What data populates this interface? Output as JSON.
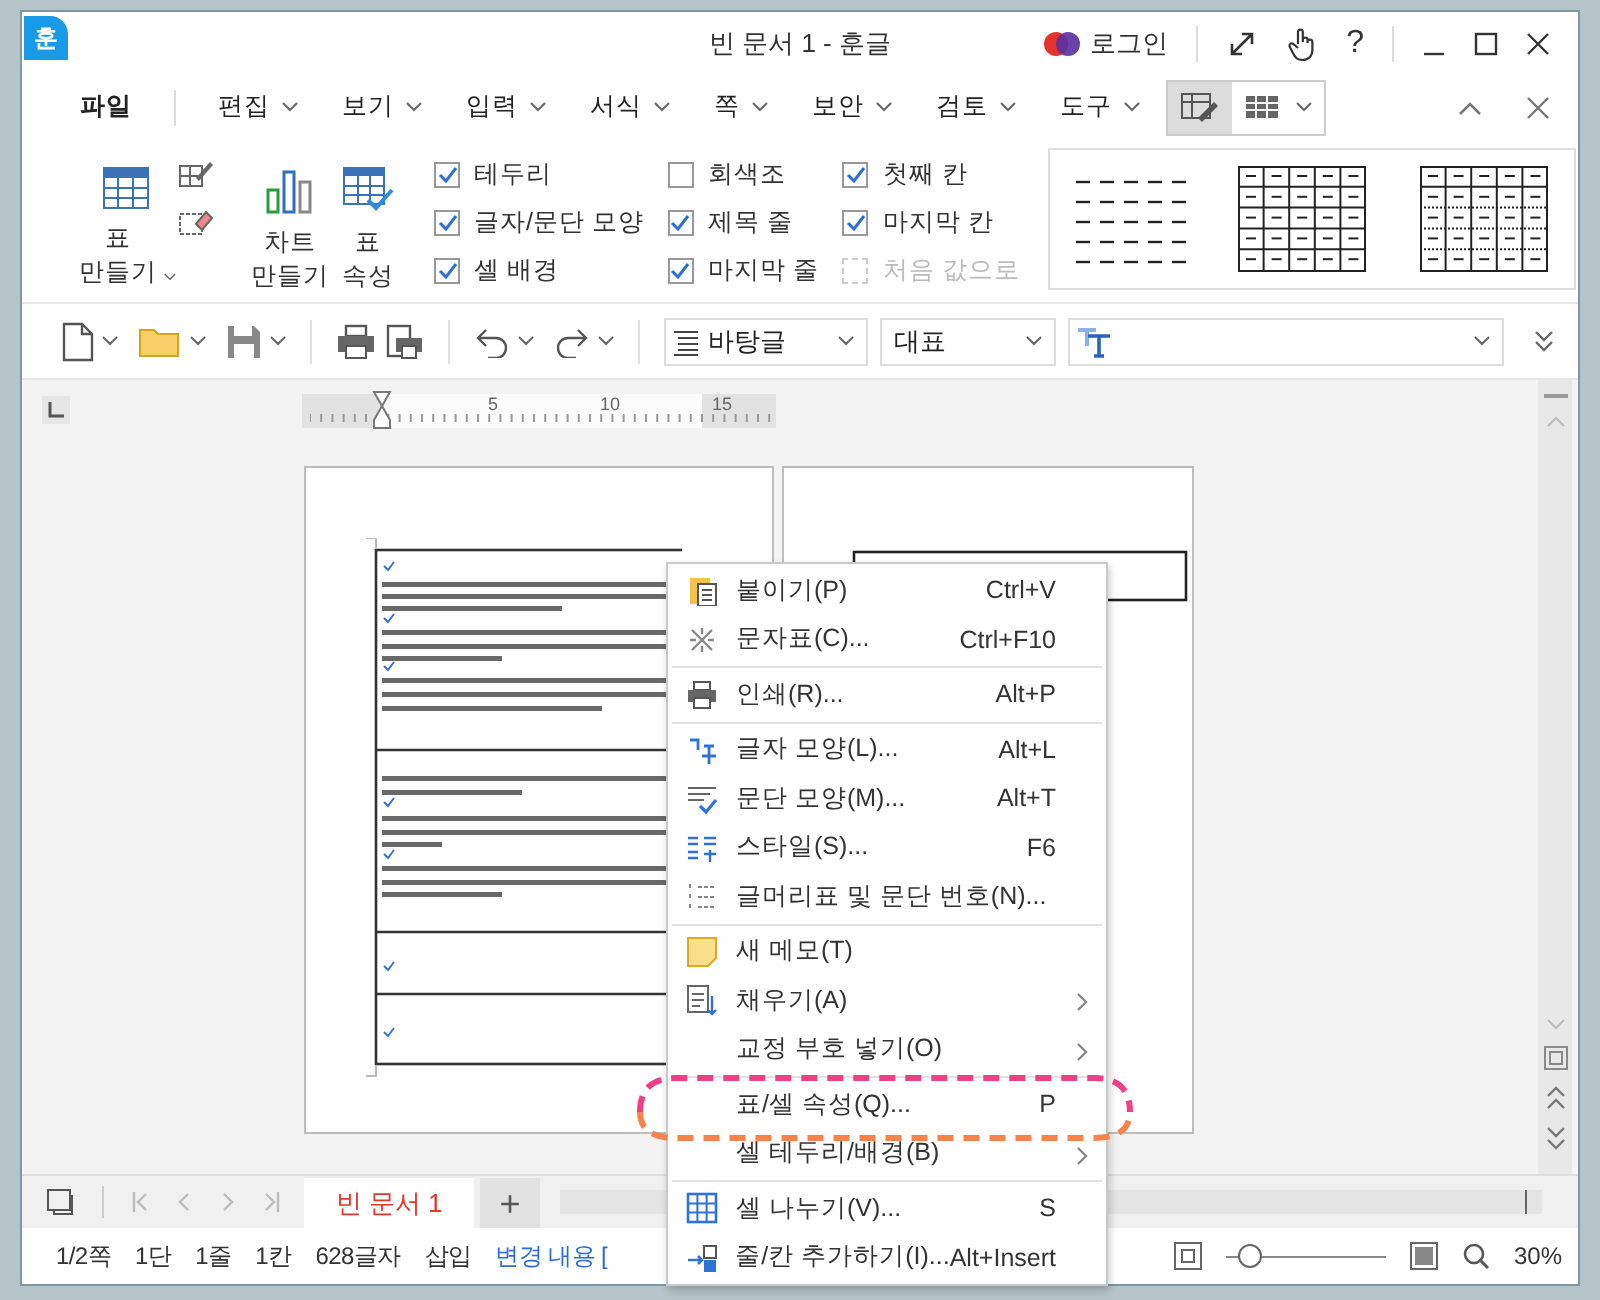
{
  "window": {
    "logo": "훈",
    "title": "빈 문서 1 - 훈글",
    "login": "로그인",
    "help": "?"
  },
  "menu_tabs": [
    {
      "label": "파일",
      "kind": "file",
      "selected": false
    },
    {
      "label": "편집",
      "kind": "menu",
      "selected": false
    },
    {
      "label": "보기",
      "kind": "menu",
      "selected": false
    },
    {
      "label": "입력",
      "kind": "menu",
      "selected": false
    },
    {
      "label": "서식",
      "kind": "menu",
      "selected": false
    },
    {
      "label": "쪽",
      "kind": "menu",
      "selected": false
    },
    {
      "label": "보안",
      "kind": "menu",
      "selected": false
    },
    {
      "label": "검토",
      "kind": "menu",
      "selected": false
    },
    {
      "label": "도구",
      "kind": "menu",
      "selected": false
    }
  ],
  "context_tabs": [
    {
      "selected": true
    },
    {
      "selected": false
    }
  ],
  "ribbon": {
    "buttons": [
      {
        "label": "표 만들기",
        "dropdown": true
      },
      {
        "label": "차트 만들기",
        "dropdown": false
      },
      {
        "label": "표 속성",
        "dropdown": false
      }
    ],
    "options": [
      {
        "label": "테두리",
        "checked": true,
        "disabled": false
      },
      {
        "label": "글자/문단 모양",
        "checked": true,
        "disabled": false
      },
      {
        "label": "셀 배경",
        "checked": true,
        "disabled": false
      },
      {
        "label": "회색조",
        "checked": false,
        "disabled": false
      },
      {
        "label": "제목 줄",
        "checked": true,
        "disabled": false
      },
      {
        "label": "마지막 줄",
        "checked": true,
        "disabled": false
      },
      {
        "label": "첫째 칸",
        "checked": true,
        "disabled": false
      },
      {
        "label": "마지막 칸",
        "checked": true,
        "disabled": false
      },
      {
        "label": "처음 값으로",
        "checked": false,
        "disabled": true
      }
    ]
  },
  "toolbar": {
    "style": "바탕글",
    "language": "대표"
  },
  "ruler": {
    "labels": [
      "5",
      "10",
      "15"
    ]
  },
  "doc_tabs": [
    {
      "label": "빈 문서 1",
      "selected": true
    }
  ],
  "new_tab": "+",
  "status_bar": {
    "items": [
      {
        "text": "1/2쪽",
        "kind": "info"
      },
      {
        "text": "1단",
        "kind": "info"
      },
      {
        "text": "1줄",
        "kind": "info"
      },
      {
        "text": "1칸",
        "kind": "info"
      },
      {
        "text": "628글자",
        "kind": "info"
      },
      {
        "text": "삽입",
        "kind": "info"
      },
      {
        "text": "변경 내용 [",
        "kind": "link"
      }
    ],
    "zoom": {
      "level": 0.15,
      "reading": "30%"
    }
  },
  "context_menu": {
    "items": [
      {
        "kind": "item",
        "label": "붙이기(P)",
        "shortcut": "Ctrl+V",
        "submenu": false,
        "annotated": false
      },
      {
        "kind": "item",
        "label": "문자표(C)...",
        "shortcut": "Ctrl+F10",
        "submenu": false,
        "annotated": false
      },
      {
        "kind": "separator"
      },
      {
        "kind": "item",
        "label": "인쇄(R)...",
        "shortcut": "Alt+P",
        "submenu": false,
        "annotated": false
      },
      {
        "kind": "separator"
      },
      {
        "kind": "item",
        "label": "글자 모양(L)...",
        "shortcut": "Alt+L",
        "submenu": false,
        "annotated": false
      },
      {
        "kind": "item",
        "label": "문단 모양(M)...",
        "shortcut": "Alt+T",
        "submenu": false,
        "annotated": false
      },
      {
        "kind": "item",
        "label": "스타일(S)...",
        "shortcut": "F6",
        "submenu": false,
        "annotated": false
      },
      {
        "kind": "item",
        "label": "글머리표 및 문단 번호(N)...",
        "submenu": false,
        "annotated": false
      },
      {
        "kind": "separator"
      },
      {
        "kind": "item",
        "label": "새 메모(T)",
        "submenu": false,
        "annotated": false
      },
      {
        "kind": "item",
        "label": "채우기(A)",
        "submenu": true,
        "annotated": false
      },
      {
        "kind": "item",
        "label": "교정 부호 넣기(O)",
        "submenu": true,
        "annotated": false
      },
      {
        "kind": "separator"
      },
      {
        "kind": "item",
        "label": "표/셀 속성(Q)...",
        "shortcut": "P",
        "submenu": false,
        "annotated": true
      },
      {
        "kind": "item",
        "label": "셀 테두리/배경(B)",
        "submenu": true,
        "annotated": false
      },
      {
        "kind": "separator"
      },
      {
        "kind": "item",
        "label": "셀 나누기(V)...",
        "shortcut": "S",
        "submenu": false,
        "annotated": false
      },
      {
        "kind": "item",
        "label": "줄/칸 추가하기(I)...",
        "shortcut": "Alt+Insert",
        "submenu": false,
        "annotated": false
      }
    ]
  }
}
